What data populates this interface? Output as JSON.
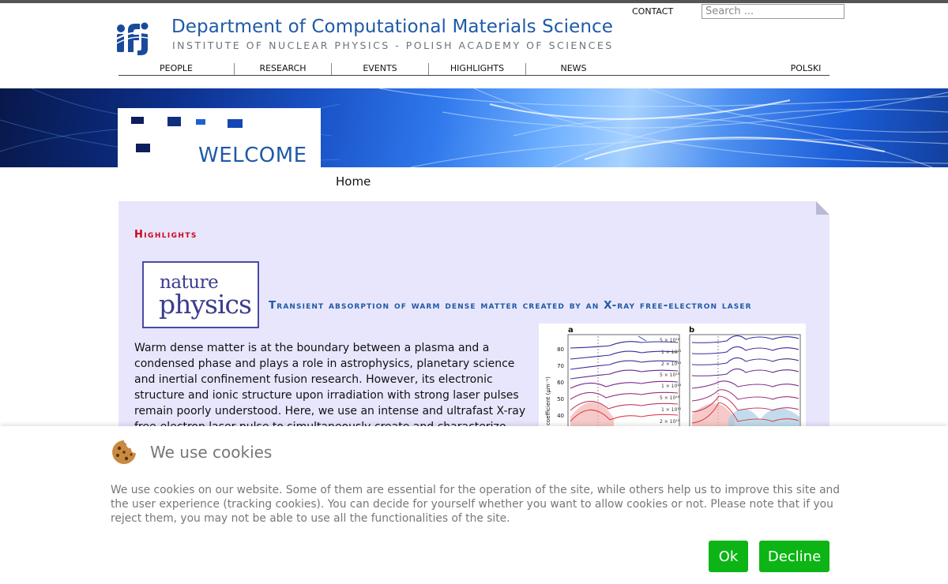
{
  "header": {
    "title": "Department of Computational Materials Science",
    "subtitle": "INSTITUTE OF NUCLEAR PHYSICS - POLISH ACADEMY OF SCIENCES",
    "contact_label": "CONTACT",
    "search_placeholder": "Search ..."
  },
  "nav": {
    "items": [
      "PEOPLE",
      "RESEARCH",
      "EVENTS",
      "HIGHLIGHTS",
      "NEWS"
    ],
    "language_label": "POLSKI"
  },
  "banner": {
    "welcome": "WELCOME"
  },
  "breadcrumb": {
    "home": "Home"
  },
  "highlights": {
    "heading": "Highlights",
    "journal_logo_line1": "nature",
    "journal_logo_line2": "physics",
    "article_title": "Transient absorption of warm dense matter created by an X-ray free-electron laser",
    "abstract": "Warm dense matter is at the boundary between a plasma and a condensed phase and plays a role in astrophysics, planetary science and inertial confinement fusion research. However, its electronic structure and ionic structure upon irradiation with strong laser pulses remain poorly understood. Here, we use an intense and ultrafast X-ray free-electron laser pulse to simultaneously create and characterize warm dense copper using"
  },
  "figure": {
    "panel_labels": [
      "a",
      "b"
    ],
    "y_axis_label": "on coefficient (µm⁻¹)",
    "y_ticks": [
      "80",
      "70",
      "60",
      "50",
      "40"
    ],
    "curve_labels": [
      "5 × 10¹²",
      "1 × 10¹³",
      "2 × 10¹³",
      "5 × 10¹³",
      "1 × 10¹⁴",
      "5 × 10¹⁴",
      "1 × 10¹⁵",
      "2 × 10¹⁵"
    ]
  },
  "cookie": {
    "title": "We use cookies",
    "text": "We use cookies on our website. Some of them are essential for the operation of the site, while others help us to improve this site and the user experience (tracking cookies). You can decide for yourself whether you want to allow cookies or not. Please note that if you reject them, you may not be able to use all the functionalities of the site.",
    "ok_label": "Ok",
    "decline_label": "Decline"
  },
  "colors": {
    "brand_blue": "#1f5aa6",
    "highlight_red": "#d0021b",
    "panel_bg": "#e8e6fd",
    "button_green": "#0cb515"
  }
}
